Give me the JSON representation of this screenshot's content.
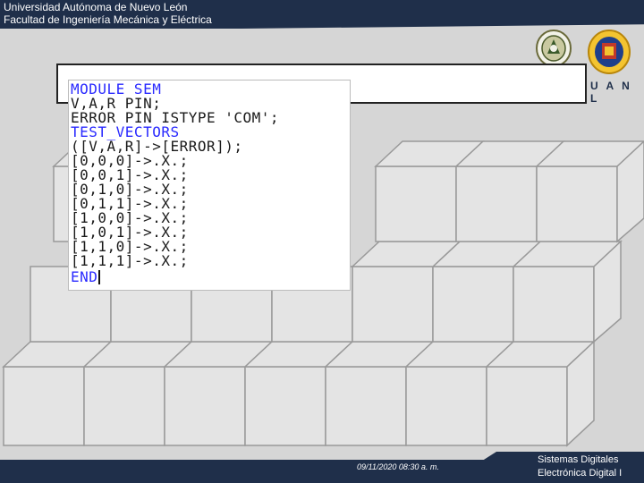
{
  "header": {
    "university": "Universidad Autónoma de Nuevo León",
    "faculty": "Facultad de Ingeniería Mecánica y Eléctrica"
  },
  "logos": {
    "fime_logo": "fime-seal-icon",
    "uanl_logo": "uanl-shield-icon",
    "uanl_text": "U A N L"
  },
  "code": {
    "lines": [
      "MODULE SEM",
      "V,A,R PIN;",
      "ERROR PIN ISTYPE 'COM';",
      "TEST_VECTORS",
      "([V,A,R]->[ERROR]);",
      "[0,0,0]->.X.;",
      "[0,0,1]->.X.;",
      "[0,1,0]->.X.;",
      "[0,1,1]->.X.;",
      "[1,0,0]->.X.;",
      "[1,0,1]->.X.;",
      "[1,1,0]->.X.;",
      "[1,1,1]->.X.;",
      "END"
    ]
  },
  "footer": {
    "date": "09/11/2020 08:30 a. m.",
    "course1": "Sistemas Digitales",
    "course2": "Electrónica Digital I"
  },
  "colors": {
    "navy": "#1f2f4a",
    "keyword_blue": "#2a2aff"
  }
}
